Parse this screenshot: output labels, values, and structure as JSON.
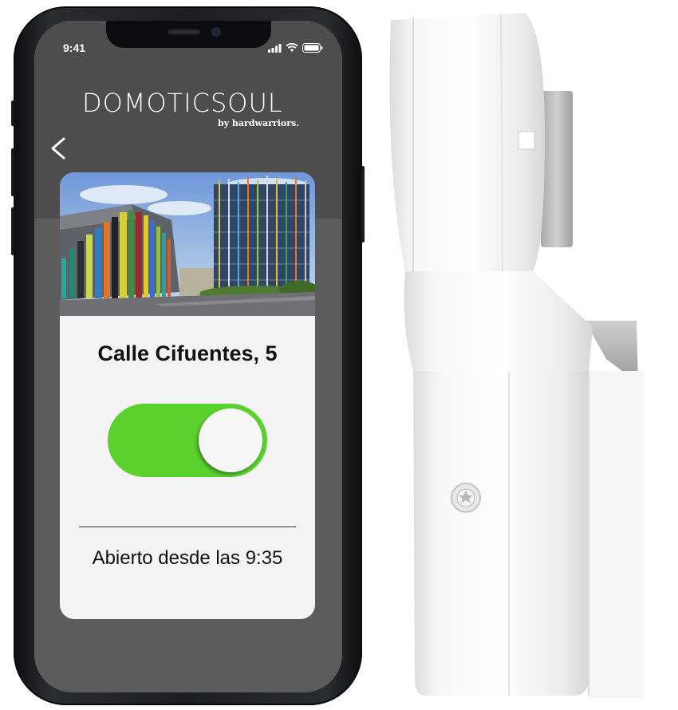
{
  "status_bar": {
    "time": "9:41"
  },
  "header": {
    "logo_main": "DOMOTICSOUL",
    "logo_sub": "by hardwarriors.",
    "back_icon": "chevron-left-icon"
  },
  "card": {
    "title": "Calle Cifuentes, 5",
    "toggle_on": true,
    "status": "Abierto desde las 9:35"
  },
  "colors": {
    "toggle_on": "#5ad12e",
    "screen_bg": "#5c5c5c",
    "card_bg": "#f4f4f4"
  }
}
